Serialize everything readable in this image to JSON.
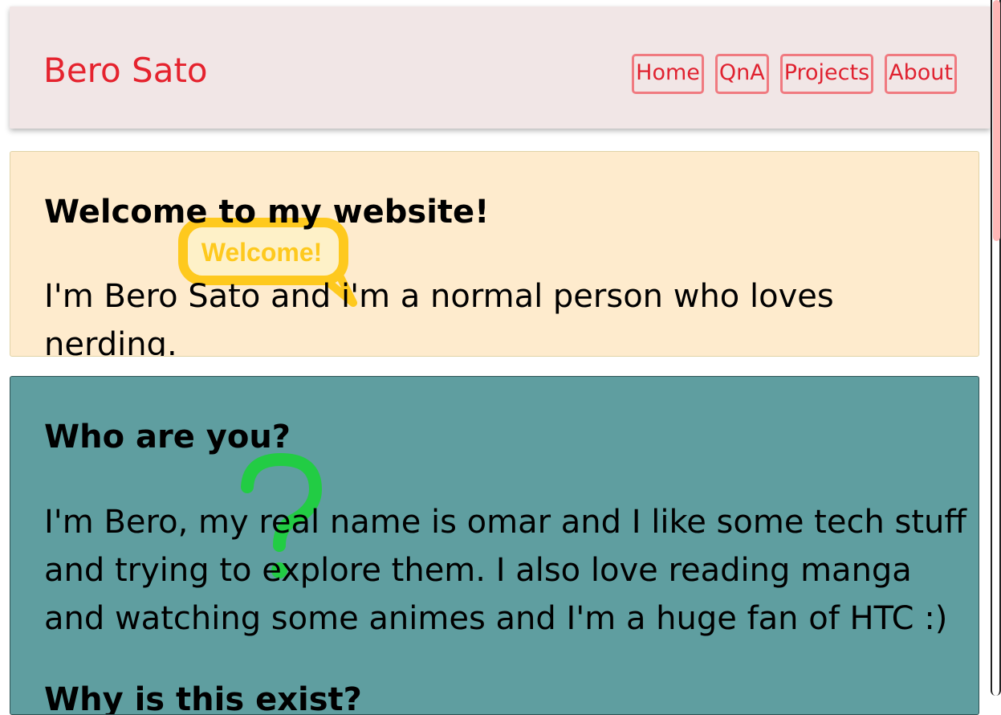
{
  "header": {
    "site_title": "Bero Sato",
    "nav": [
      "Home",
      "QnA",
      "Projects",
      "About"
    ]
  },
  "welcome": {
    "title": "Welcome to my website!",
    "text": "I'm Bero Sato and i'm a normal person who loves nerding.",
    "graphic_label": "Welcome!"
  },
  "who": {
    "title": "Who are you?",
    "text": "I'm Bero, my real name is omar and I like some tech stuff and trying to explore them. I also love reading manga and watching some animes and I'm a huge fan of HTC :)",
    "next_title": "Why is this exist?"
  },
  "colors": {
    "accent": "#e5232e",
    "header_bg": "#f1e6e6",
    "welcome_bg": "#feebcd",
    "who_bg": "#5f9ea0",
    "question_mark": "#22cc44",
    "welcome_graphic": "#ffc400"
  },
  "icons": [
    "welcome-speech-bubble-icon",
    "question-mark-icon"
  ]
}
